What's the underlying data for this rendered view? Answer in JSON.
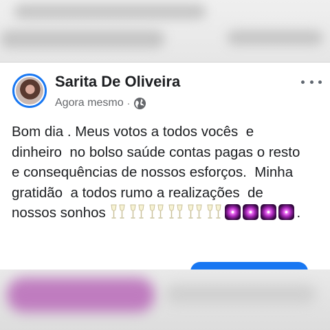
{
  "post": {
    "author": "Sarita De Oliveira",
    "timestamp": "Agora mesmo",
    "separator": "·",
    "privacy_icon": "globe-icon",
    "more_icon": "more-options-icon",
    "text": "Bom dia . Meus votos a todos vocês  e dinheiro  no bolso saúde contas pagas o resto e consequências de nossos esforços.  Minha gratidão  a todos rumo a realizações  de nossos sonhos",
    "emoji_end": "."
  },
  "colors": {
    "accent": "#1877f2",
    "text": "#1c1e21",
    "secondary_text": "#65676b"
  }
}
